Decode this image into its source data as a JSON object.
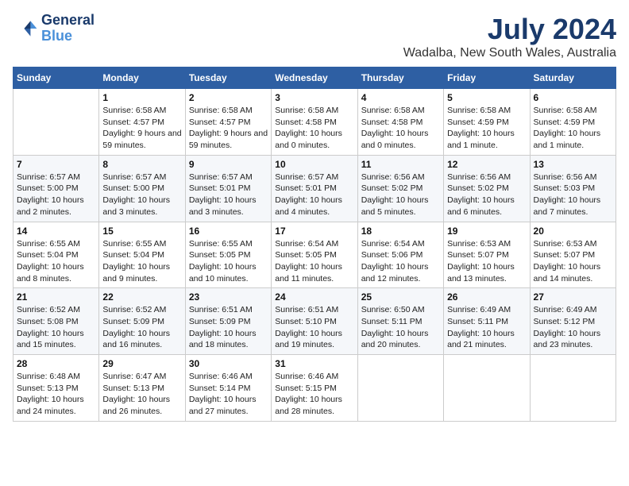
{
  "logo": {
    "line1": "General",
    "line2": "Blue"
  },
  "title": "July 2024",
  "location": "Wadalba, New South Wales, Australia",
  "days_of_week": [
    "Sunday",
    "Monday",
    "Tuesday",
    "Wednesday",
    "Thursday",
    "Friday",
    "Saturday"
  ],
  "weeks": [
    [
      null,
      {
        "day": 1,
        "sunrise": "6:58 AM",
        "sunset": "4:57 PM",
        "daylight": "9 hours and 59 minutes."
      },
      {
        "day": 2,
        "sunrise": "6:58 AM",
        "sunset": "4:57 PM",
        "daylight": "9 hours and 59 minutes."
      },
      {
        "day": 3,
        "sunrise": "6:58 AM",
        "sunset": "4:58 PM",
        "daylight": "10 hours and 0 minutes."
      },
      {
        "day": 4,
        "sunrise": "6:58 AM",
        "sunset": "4:58 PM",
        "daylight": "10 hours and 0 minutes."
      },
      {
        "day": 5,
        "sunrise": "6:58 AM",
        "sunset": "4:59 PM",
        "daylight": "10 hours and 1 minute."
      },
      {
        "day": 6,
        "sunrise": "6:58 AM",
        "sunset": "4:59 PM",
        "daylight": "10 hours and 1 minute."
      }
    ],
    [
      {
        "day": 7,
        "sunrise": "6:57 AM",
        "sunset": "5:00 PM",
        "daylight": "10 hours and 2 minutes."
      },
      {
        "day": 8,
        "sunrise": "6:57 AM",
        "sunset": "5:00 PM",
        "daylight": "10 hours and 3 minutes."
      },
      {
        "day": 9,
        "sunrise": "6:57 AM",
        "sunset": "5:01 PM",
        "daylight": "10 hours and 3 minutes."
      },
      {
        "day": 10,
        "sunrise": "6:57 AM",
        "sunset": "5:01 PM",
        "daylight": "10 hours and 4 minutes."
      },
      {
        "day": 11,
        "sunrise": "6:56 AM",
        "sunset": "5:02 PM",
        "daylight": "10 hours and 5 minutes."
      },
      {
        "day": 12,
        "sunrise": "6:56 AM",
        "sunset": "5:02 PM",
        "daylight": "10 hours and 6 minutes."
      },
      {
        "day": 13,
        "sunrise": "6:56 AM",
        "sunset": "5:03 PM",
        "daylight": "10 hours and 7 minutes."
      }
    ],
    [
      {
        "day": 14,
        "sunrise": "6:55 AM",
        "sunset": "5:04 PM",
        "daylight": "10 hours and 8 minutes."
      },
      {
        "day": 15,
        "sunrise": "6:55 AM",
        "sunset": "5:04 PM",
        "daylight": "10 hours and 9 minutes."
      },
      {
        "day": 16,
        "sunrise": "6:55 AM",
        "sunset": "5:05 PM",
        "daylight": "10 hours and 10 minutes."
      },
      {
        "day": 17,
        "sunrise": "6:54 AM",
        "sunset": "5:05 PM",
        "daylight": "10 hours and 11 minutes."
      },
      {
        "day": 18,
        "sunrise": "6:54 AM",
        "sunset": "5:06 PM",
        "daylight": "10 hours and 12 minutes."
      },
      {
        "day": 19,
        "sunrise": "6:53 AM",
        "sunset": "5:07 PM",
        "daylight": "10 hours and 13 minutes."
      },
      {
        "day": 20,
        "sunrise": "6:53 AM",
        "sunset": "5:07 PM",
        "daylight": "10 hours and 14 minutes."
      }
    ],
    [
      {
        "day": 21,
        "sunrise": "6:52 AM",
        "sunset": "5:08 PM",
        "daylight": "10 hours and 15 minutes."
      },
      {
        "day": 22,
        "sunrise": "6:52 AM",
        "sunset": "5:09 PM",
        "daylight": "10 hours and 16 minutes."
      },
      {
        "day": 23,
        "sunrise": "6:51 AM",
        "sunset": "5:09 PM",
        "daylight": "10 hours and 18 minutes."
      },
      {
        "day": 24,
        "sunrise": "6:51 AM",
        "sunset": "5:10 PM",
        "daylight": "10 hours and 19 minutes."
      },
      {
        "day": 25,
        "sunrise": "6:50 AM",
        "sunset": "5:11 PM",
        "daylight": "10 hours and 20 minutes."
      },
      {
        "day": 26,
        "sunrise": "6:49 AM",
        "sunset": "5:11 PM",
        "daylight": "10 hours and 21 minutes."
      },
      {
        "day": 27,
        "sunrise": "6:49 AM",
        "sunset": "5:12 PM",
        "daylight": "10 hours and 23 minutes."
      }
    ],
    [
      {
        "day": 28,
        "sunrise": "6:48 AM",
        "sunset": "5:13 PM",
        "daylight": "10 hours and 24 minutes."
      },
      {
        "day": 29,
        "sunrise": "6:47 AM",
        "sunset": "5:13 PM",
        "daylight": "10 hours and 26 minutes."
      },
      {
        "day": 30,
        "sunrise": "6:46 AM",
        "sunset": "5:14 PM",
        "daylight": "10 hours and 27 minutes."
      },
      {
        "day": 31,
        "sunrise": "6:46 AM",
        "sunset": "5:15 PM",
        "daylight": "10 hours and 28 minutes."
      },
      null,
      null,
      null
    ]
  ]
}
